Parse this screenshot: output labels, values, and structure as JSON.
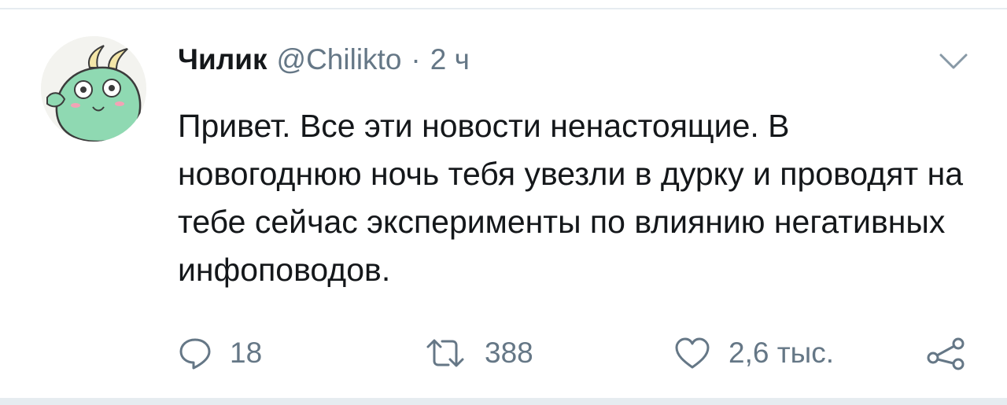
{
  "tweet": {
    "display_name": "Чилик",
    "handle": "@Chilikto",
    "separator": "·",
    "time": "2 ч",
    "text": "Привет. Все эти новости ненастоящие. В новогоднюю ночь тебя увезли в дурку и проводят на тебе сейчас эксперименты по влиянию негативных инфоповодов.",
    "avatar_icon": "green-cartoon-creature-avatar",
    "menu_icon": "chevron-down-icon"
  },
  "actions": {
    "reply": {
      "icon": "reply-icon",
      "count": "18"
    },
    "retweet": {
      "icon": "retweet-icon",
      "count": "388"
    },
    "like": {
      "icon": "heart-icon",
      "count": "2,6 тыс."
    },
    "share": {
      "icon": "share-icon"
    }
  },
  "colors": {
    "text_primary": "#14171a",
    "text_secondary": "#657786",
    "divider": "#e6ecf0",
    "avatar_green": "#8fd9b2"
  }
}
